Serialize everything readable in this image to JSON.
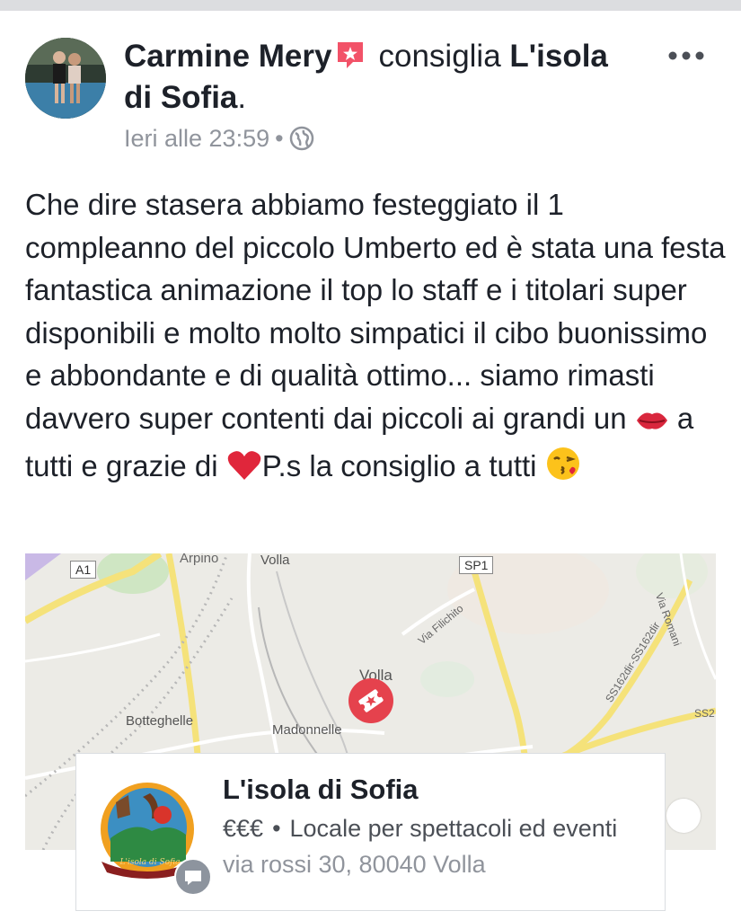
{
  "post": {
    "author": "Carmine Mery",
    "verb": "consiglia",
    "page_line1": "L'isola",
    "page_line2": "di Sofia",
    "period": ".",
    "timestamp": "Ieri alle 23:59",
    "meta_separator": "•",
    "text_parts": {
      "p1": "Che dire stasera abbiamo festeggiato il 1 compleanno del piccolo Umberto ed è stata una festa fantastica animazione il top lo staff e i titolari super disponibili e molto molto simpatici il cibo buonissimo e abbondante e di qualità ottimo... siamo rimasti davvero super contenti dai piccoli ai grandi un ",
      "p2": " a tutti e grazie di ",
      "p3": "P.s la consiglio a tutti ",
      "emoji_kiss_lips": "💋",
      "emoji_heart": "❤️",
      "emoji_kiss_face": "😘"
    }
  },
  "map": {
    "labels": {
      "arpino": "Arpino",
      "volla_top": "Volla",
      "a1": "A1",
      "sp1": "SP1",
      "via_romani": "Via Romani",
      "via_filichito": "Via Filichito",
      "ss162": "SS162dir-SS162dir",
      "volla_center": "Volla",
      "botteghelle": "Botteghelle",
      "madonnelle": "Madonnelle",
      "ss2": "SS2"
    }
  },
  "card": {
    "title": "L'isola di Sofia",
    "price": "€€€",
    "dot": "•",
    "category": "Locale per spettacoli ed eventi",
    "address": "via rossi 30, 80040 Volla",
    "logo_text": "L'isola di Sofia"
  },
  "colors": {
    "accent_pin": "#e5424d",
    "text_primary": "#1d2129",
    "text_secondary": "#90949c",
    "map_bg": "#ecebe6",
    "map_road": "#f5e27a"
  },
  "icons": {
    "more": "more-dots-icon",
    "globe": "globe-icon",
    "badge": "recommendation-badge-icon",
    "pin": "map-pin-ticket-icon",
    "messenger": "message-icon"
  }
}
